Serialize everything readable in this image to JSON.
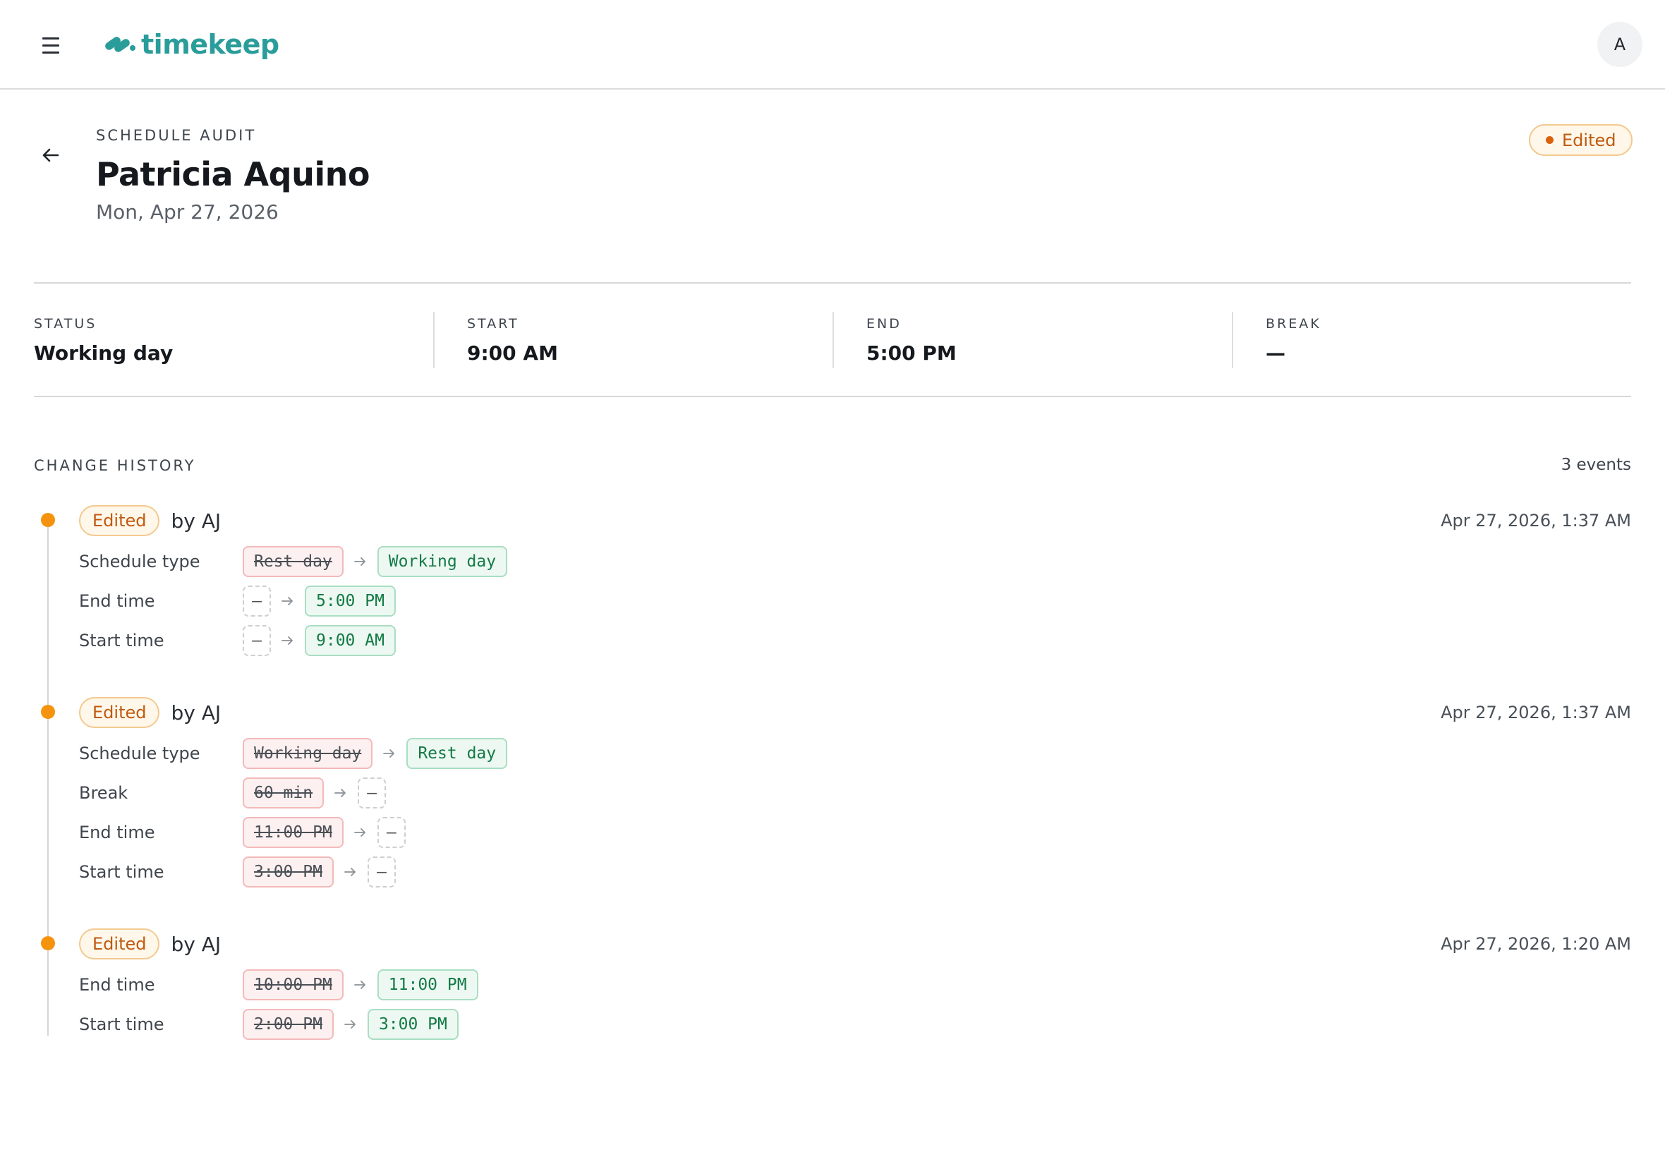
{
  "app": {
    "name": "timekeep",
    "user_initial": "A"
  },
  "header": {
    "eyebrow": "SCHEDULE AUDIT",
    "title": "Patricia Aquino",
    "date": "Mon, Apr 27, 2026",
    "status_badge": "Edited"
  },
  "summary": {
    "status": {
      "label": "STATUS",
      "value": "Working day"
    },
    "start": {
      "label": "START",
      "value": "9:00 AM"
    },
    "end": {
      "label": "END",
      "value": "5:00 PM"
    },
    "break": {
      "label": "BREAK",
      "value": "—"
    }
  },
  "history": {
    "title": "CHANGE HISTORY",
    "count": "3 events",
    "events": [
      {
        "badge": "Edited",
        "by": "by AJ",
        "time": "Apr 27, 2026, 1:37 AM",
        "changes": [
          {
            "label": "Schedule type",
            "old": "Rest day",
            "new": "Working day"
          },
          {
            "label": "End time",
            "old": "—",
            "new": "5:00 PM"
          },
          {
            "label": "Start time",
            "old": "—",
            "new": "9:00 AM"
          }
        ]
      },
      {
        "badge": "Edited",
        "by": "by AJ",
        "time": "Apr 27, 2026, 1:37 AM",
        "changes": [
          {
            "label": "Schedule type",
            "old": "Working day",
            "new": "Rest day"
          },
          {
            "label": "Break",
            "old": "60 min",
            "new": "—"
          },
          {
            "label": "End time",
            "old": "11:00 PM",
            "new": "—"
          },
          {
            "label": "Start time",
            "old": "3:00 PM",
            "new": "—"
          }
        ]
      },
      {
        "badge": "Edited",
        "by": "by AJ",
        "time": "Apr 27, 2026, 1:20 AM",
        "changes": [
          {
            "label": "End time",
            "old": "10:00 PM",
            "new": "11:00 PM"
          },
          {
            "label": "Start time",
            "old": "2:00 PM",
            "new": "3:00 PM"
          }
        ]
      }
    ]
  },
  "icons": {
    "menu": "hamburger-menu-icon",
    "back": "arrow-left-icon",
    "change_arrow": "arrow-right-icon",
    "logo": "timekeep-logo-icon"
  },
  "colors": {
    "brand": "#2a9d9a",
    "edited_text": "#c05a0f",
    "timeline_dot": "#f5930f",
    "new_value": "#137a45"
  }
}
